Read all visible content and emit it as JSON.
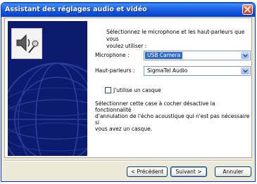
{
  "window": {
    "title": "Assistant des réglages audio et vidéo"
  },
  "main": {
    "intro_line1": "Sélectionnez le microphone et les haut-parleurs que vous",
    "intro_line2": "voulez utiliser :",
    "microphone_label": "Microphone :",
    "microphone_value": "USB Camera",
    "speakers_label": "Haut-parleurs :",
    "speakers_value": "SigmaTel Audio",
    "headset_label": "J'utilise un casque",
    "headset_checked": false,
    "description_line1": "Sélectionner cette case à cocher désactive la fonctionnalité",
    "description_line2": "d'annulation de l'écho acoustique qui n'est pas nécessaire si",
    "description_line3": "vous avez un casque."
  },
  "footer": {
    "previous_label": "< Précédent",
    "next_label": "Suivant >",
    "cancel_label": "Annuler"
  },
  "icons": {
    "close": "close-icon",
    "speaker": "speaker-microphone-icon",
    "dropdown": "chevron-down-icon"
  },
  "colors": {
    "titlebar": "#0a5ae4",
    "side_panel": "#0c1b6e",
    "selection": "#316ac5",
    "close_button": "#d8452a"
  }
}
